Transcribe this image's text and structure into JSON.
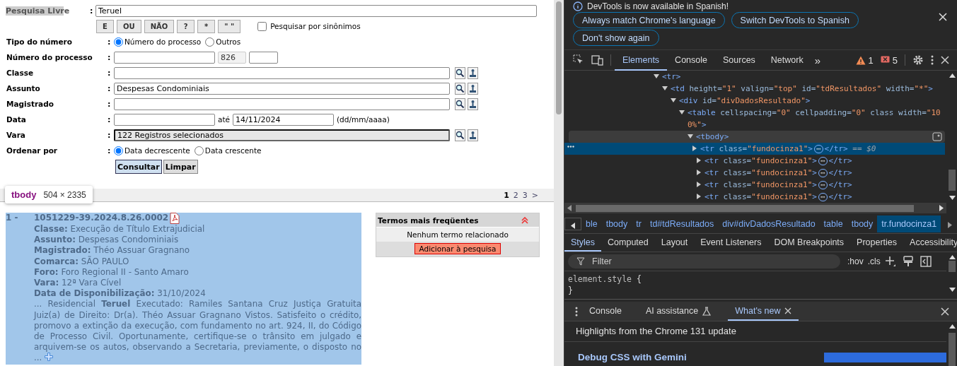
{
  "page": {
    "search": {
      "label": "Pesquisa Livre",
      "separator": ":",
      "value": "Teruel",
      "operators": [
        "E",
        "OU",
        "NÃO",
        "?",
        "*",
        "\" \""
      ],
      "synonyms": {
        "label": "Pesquisar por sinônimos",
        "checked": false
      }
    },
    "form": [
      {
        "label": "Tipo do número",
        "separator": ":",
        "kind": "radio",
        "options": [
          {
            "label": "Número do processo",
            "selected": true
          },
          {
            "label": "Outros",
            "selected": false
          }
        ]
      },
      {
        "label": "Número do processo",
        "separator": ":",
        "kind": "triple",
        "inputs": [
          {
            "disabled": false
          },
          {
            "value": "826",
            "disabled": true
          },
          {
            "disabled": false
          }
        ]
      },
      {
        "label": "Classe",
        "separator": ":",
        "kind": "lookup",
        "disabled": false
      },
      {
        "label": "Assunto",
        "separator": ":",
        "kind": "lookup",
        "value": "Despesas Condominiais",
        "disabled": false
      },
      {
        "label": "Magistrado",
        "separator": ":",
        "kind": "lookup",
        "disabled": false
      },
      {
        "label": "Data",
        "separator": ":",
        "kind": "date",
        "connector": "até",
        "end": "14/11/2024",
        "hint": "(dd/mm/aaaa)"
      },
      {
        "label": "Vara",
        "separator": ":",
        "kind": "lookup",
        "value": "122 Registros selecionados",
        "disabled": true
      },
      {
        "label": "Ordenar por",
        "separator": ":",
        "kind": "radio",
        "options": [
          {
            "label": "Data decrescente",
            "selected": true
          },
          {
            "label": "Data crescente",
            "selected": false
          }
        ]
      }
    ],
    "actions": [
      {
        "label": "Consultar",
        "primary": true
      },
      {
        "label": "Limpar",
        "primary": false
      }
    ],
    "tooltip": {
      "tag": "tbody",
      "size": "504 × 2335"
    },
    "pagination": [
      {
        "label": "1",
        "selected": true
      },
      {
        "label": "2",
        "selected": false
      },
      {
        "label": "3",
        "selected": false
      },
      {
        "label": ">",
        "selected": false
      }
    ],
    "result": {
      "index": "1 -",
      "number": "1051229-39.2024.8.26.0002",
      "fields": [
        {
          "label": "Classe:",
          "value": "Execução de Título Extrajudicial"
        },
        {
          "label": "Assunto:",
          "value": "Despesas Condominiais"
        },
        {
          "label": "Magistrado:",
          "value": "Théo Assuar Gragnano"
        },
        {
          "label": "Comarca:",
          "value": "SÃO PAULO"
        },
        {
          "label": "Foro:",
          "value": "Foro Regional II - Santo Amaro"
        },
        {
          "label": "Vara:",
          "value": "12ª Vara Cível"
        },
        {
          "label": "Data de Disponibilização:",
          "value": "31/10/2024"
        }
      ],
      "excerpt": "... Residencial **Teruel** Executado: Ramiles Santana Cruz Justiça Gratuita Juiz(a) de Direito: Dr(a). Théo Assuar Gragnano Vistos. Satisfeito o crédito, promovo a extinção da execução, com fundamento no art. 924, II, do Código de Processo Civil. Oportunamente, certifique-se o trânsito em julgado e arquivem-se os autos, observando a Secretaria, previamente, o disposto no ..."
    },
    "terms": {
      "title": "Termos mais freqüentes",
      "empty": "Nenhum termo relacionado",
      "button": "Adicionar à pesquisa"
    }
  },
  "devtools": {
    "infobar": {
      "message": "DevTools is now available in Spanish!",
      "buttons": [
        "Always match Chrome's language",
        "Switch DevTools to Spanish",
        "Don't show again"
      ]
    },
    "tabs": [
      {
        "label": "Elements",
        "selected": true
      },
      {
        "label": "Console",
        "selected": false
      },
      {
        "label": "Sources",
        "selected": false
      },
      {
        "label": "Network",
        "selected": false
      }
    ],
    "more": "»",
    "warnings": "1",
    "errors": "5",
    "tree": [
      {
        "expanded": true,
        "selected": false,
        "hovered": false,
        "segments": [
          {
            "kind": "tag",
            "text": "<tr>"
          }
        ],
        "children": [
          {
            "expanded": true,
            "selected": false,
            "hovered": false,
            "segments": [
              {
                "kind": "tag",
                "text": "<td"
              },
              {
                "kind": "attr",
                "text": " height="
              },
              {
                "kind": "value",
                "text": "\"1\""
              },
              {
                "kind": "attr",
                "text": " valign="
              },
              {
                "kind": "value",
                "text": "\"top\""
              },
              {
                "kind": "attr",
                "text": " id="
              },
              {
                "kind": "value",
                "text": "\"tdResultados\""
              },
              {
                "kind": "attr",
                "text": " width="
              },
              {
                "kind": "value",
                "text": "\"*\""
              },
              {
                "kind": "tag",
                "text": ">"
              }
            ],
            "children": [
              {
                "expanded": true,
                "selected": false,
                "hovered": false,
                "segments": [
                  {
                    "kind": "tag",
                    "text": "<div"
                  },
                  {
                    "kind": "attr",
                    "text": " id="
                  },
                  {
                    "kind": "value",
                    "text": "\"divDadosResultado\""
                  },
                  {
                    "kind": "tag",
                    "text": ">"
                  }
                ],
                "children": [
                  {
                    "expanded": true,
                    "selected": false,
                    "hovered": false,
                    "segments": [
                      {
                        "kind": "tag",
                        "text": "<table"
                      },
                      {
                        "kind": "attr",
                        "text": " cellspacing="
                      },
                      {
                        "kind": "value",
                        "text": "\"0\""
                      },
                      {
                        "kind": "attr",
                        "text": " cellpadding="
                      },
                      {
                        "kind": "value",
                        "text": "\"0\""
                      },
                      {
                        "kind": "attr",
                        "text": " class width="
                      },
                      {
                        "kind": "value",
                        "text": "\"100%\""
                      },
                      {
                        "kind": "tag",
                        "text": ">"
                      }
                    ],
                    "children": [
                      {
                        "expanded": true,
                        "selected": false,
                        "hovered": true,
                        "segments": [
                          {
                            "kind": "tag",
                            "text": "<tbody>"
                          }
                        ],
                        "children": [
                          {
                            "expanded": false,
                            "selected": true,
                            "hovered": false,
                            "segments": [
                              {
                                "kind": "tag",
                                "text": "<tr"
                              },
                              {
                                "kind": "attr",
                                "text": " class="
                              },
                              {
                                "kind": "value",
                                "text": "\"fundocinza1\""
                              },
                              {
                                "kind": "tag",
                                "text": ">"
                              },
                              {
                                "kind": "badge",
                                "text": "⋯"
                              },
                              {
                                "kind": "tag",
                                "text": "</tr>"
                              },
                              {
                                "kind": "ref",
                                "text": " == $0"
                              }
                            ]
                          },
                          {
                            "expanded": false,
                            "selected": false,
                            "hovered": false,
                            "segments": [
                              {
                                "kind": "tag",
                                "text": "<tr"
                              },
                              {
                                "kind": "attr",
                                "text": " class="
                              },
                              {
                                "kind": "value",
                                "text": "\"fundocinza1\""
                              },
                              {
                                "kind": "tag",
                                "text": ">"
                              },
                              {
                                "kind": "badge",
                                "text": "⋯"
                              },
                              {
                                "kind": "tag",
                                "text": "</tr>"
                              }
                            ]
                          },
                          {
                            "expanded": false,
                            "selected": false,
                            "hovered": false,
                            "segments": [
                              {
                                "kind": "tag",
                                "text": "<tr"
                              },
                              {
                                "kind": "attr",
                                "text": " class="
                              },
                              {
                                "kind": "value",
                                "text": "\"fundocinza1\""
                              },
                              {
                                "kind": "tag",
                                "text": ">"
                              },
                              {
                                "kind": "badge",
                                "text": "⋯"
                              },
                              {
                                "kind": "tag",
                                "text": "</tr>"
                              }
                            ]
                          },
                          {
                            "expanded": false,
                            "selected": false,
                            "hovered": false,
                            "segments": [
                              {
                                "kind": "tag",
                                "text": "<tr"
                              },
                              {
                                "kind": "attr",
                                "text": " class="
                              },
                              {
                                "kind": "value",
                                "text": "\"fundocinza1\""
                              },
                              {
                                "kind": "tag",
                                "text": ">"
                              },
                              {
                                "kind": "badge",
                                "text": "⋯"
                              },
                              {
                                "kind": "tag",
                                "text": "</tr>"
                              }
                            ]
                          },
                          {
                            "expanded": false,
                            "selected": false,
                            "hovered": false,
                            "segments": [
                              {
                                "kind": "tag",
                                "text": "<tr"
                              },
                              {
                                "kind": "attr",
                                "text": " class="
                              },
                              {
                                "kind": "value",
                                "text": "\"fundocinza1\""
                              },
                              {
                                "kind": "tag",
                                "text": ">"
                              },
                              {
                                "kind": "badge",
                                "text": "⋯"
                              },
                              {
                                "kind": "tag",
                                "text": "</tr>"
                              }
                            ]
                          }
                        ]
                      }
                    ]
                  }
                ]
              }
            ]
          }
        ]
      }
    ],
    "breadcrumbs": [
      {
        "label": "ble",
        "selected": false
      },
      {
        "label": "tbody",
        "selected": false
      },
      {
        "label": "tr",
        "selected": false
      },
      {
        "label": "td#tdResultados",
        "selected": false
      },
      {
        "label": "div#divDadosResultado",
        "selected": false
      },
      {
        "label": "table",
        "selected": false
      },
      {
        "label": "tbody",
        "selected": false
      },
      {
        "label": "tr.fundocinza1",
        "selected": true
      }
    ],
    "style_tabs": [
      {
        "label": "Styles",
        "selected": true
      },
      {
        "label": "Computed",
        "selected": false
      },
      {
        "label": "Layout",
        "selected": false
      },
      {
        "label": "Event Listeners",
        "selected": false
      },
      {
        "label": "DOM Breakpoints",
        "selected": false
      },
      {
        "label": "Properties",
        "selected": false
      },
      {
        "label": "Accessibility",
        "selected": false
      }
    ],
    "filter": {
      "placeholder": "Filter",
      "hov": ":hov",
      "cls": ".cls"
    },
    "rule": {
      "selector": "element.style",
      "open": "{",
      "close": "}"
    },
    "drawer_tabs": [
      {
        "label": "Console",
        "selected": false,
        "kind": "plain"
      },
      {
        "label": "AI assistance",
        "selected": false,
        "kind": "flask"
      },
      {
        "label": "What's new",
        "selected": true,
        "kind": "closable"
      }
    ],
    "whats_new": {
      "headline": "Highlights from the Chrome 131 update",
      "article": "Debug CSS with Gemini"
    }
  }
}
